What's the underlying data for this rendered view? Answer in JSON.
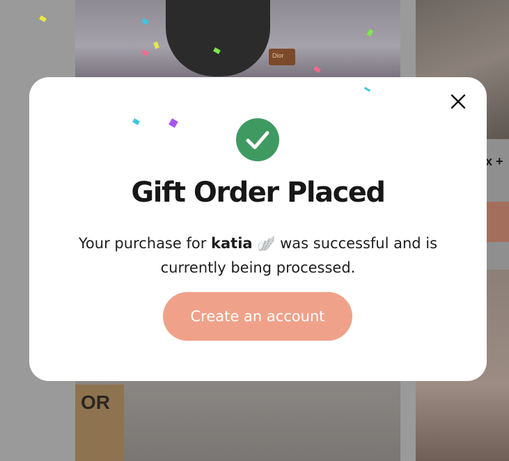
{
  "background": {
    "partial_button_label": "x +",
    "sign_text": "OR",
    "bag_tag_text": "Dior"
  },
  "modal": {
    "title": "Gift Order Placed",
    "message_prefix": "Your purchase for",
    "recipient_name": "katia",
    "recipient_emoji": "🪽",
    "message_suffix": "was successful and is currently being processed.",
    "cta_label": "Create an account",
    "close_icon": "close-icon",
    "success_icon": "check-circle-icon"
  },
  "colors": {
    "success_green": "#3f9a62",
    "cta_salmon": "#f0a18a",
    "modal_bg": "#ffffff",
    "overlay": "#9a9a9a"
  }
}
